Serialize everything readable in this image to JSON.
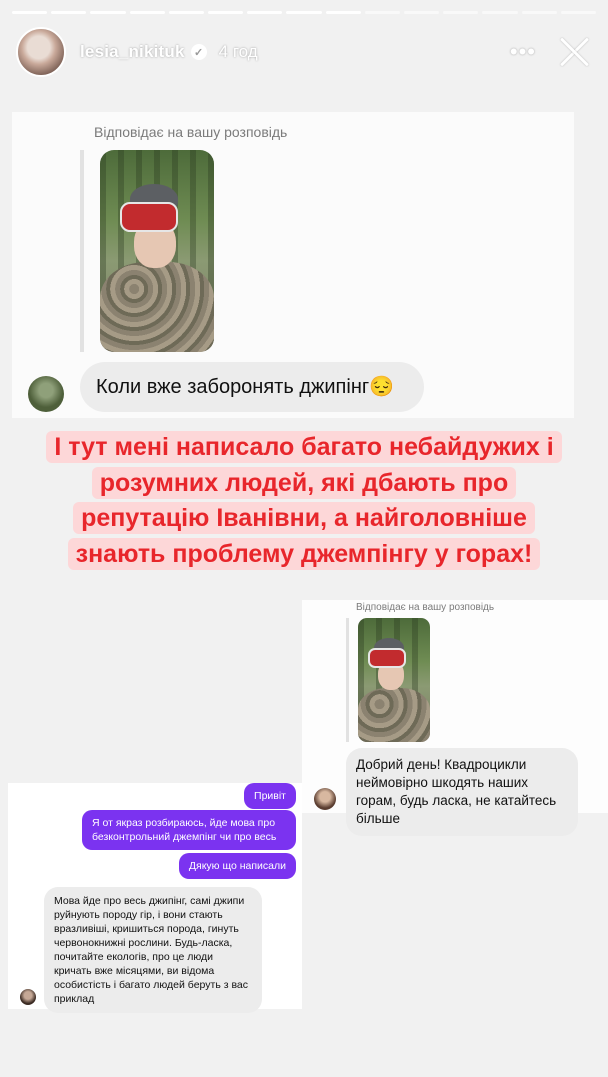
{
  "story": {
    "progress_segments": 15,
    "active_segments": 9,
    "username": "lesia_nikituk",
    "time": "4 год"
  },
  "card1": {
    "reply_label": "Відповідає на вашу розповідь",
    "message": "Коли вже заборонять джипінг😔"
  },
  "caption": {
    "lines": [
      "І тут мені написало багато небайдужих і",
      "розумних людей, які дбають про",
      "репутацію Іванівни, а найголовніше",
      "знають проблему джемпінгу у горах!"
    ]
  },
  "card2": {
    "reply_label": "Відповідає на вашу розповідь",
    "message": "Добрий день! Квадроцикли неймовірно шкодять наших горам, будь ласка, не катайтесь більше"
  },
  "card3": {
    "out1": "Привіт",
    "out2": "Я от якраз розбираюсь, йде мова про безконтрольний джемпінг чи про весь",
    "out3": "Дякую що написали",
    "in1": "Мова йде про весь джипінг, самі джипи руйнують породу гір, і вони стають вразливіші, кришиться порода, гинуть червонокнижні рослини. Будь-ласка, почитайте екологів, про це люди кричать вже місяцями, ви відома особистість і багато людей беруть з вас приклад"
  },
  "icons": {
    "verified": "verified-badge-icon",
    "more": "more-icon",
    "close": "close-icon"
  },
  "colors": {
    "caption_text": "#e8262b",
    "caption_highlight": "#fdd7d8",
    "outgoing_bubble": "#7b33f0",
    "incoming_bubble": "#ececec"
  }
}
